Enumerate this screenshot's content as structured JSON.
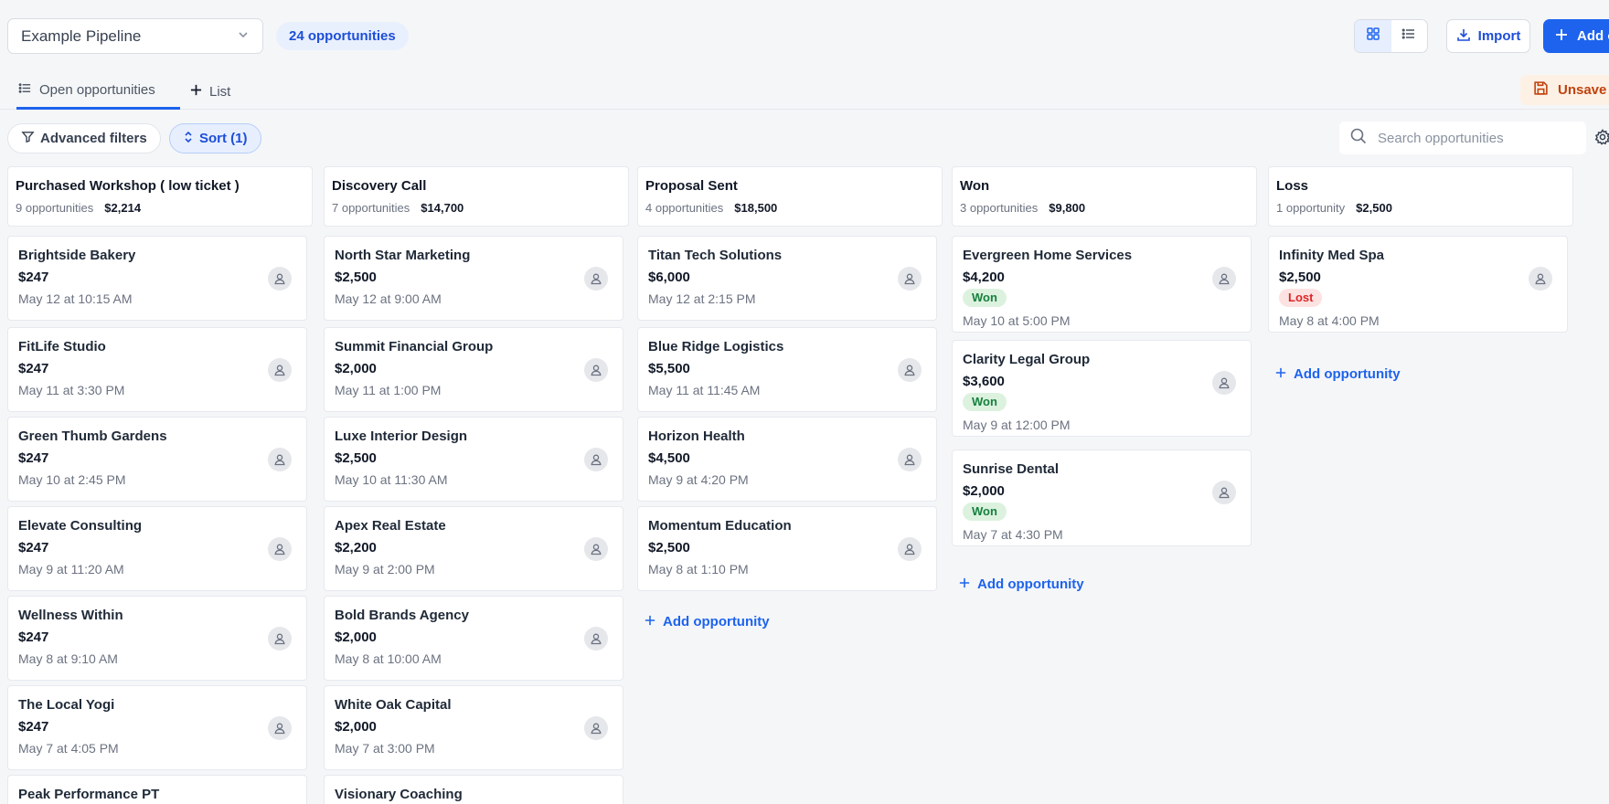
{
  "header": {
    "pipeline": "Example Pipeline",
    "opportunity_count": "24 opportunities",
    "import_label": "Import",
    "add_label": "Add o"
  },
  "tabs": {
    "open": "Open opportunities",
    "list": "List",
    "unsaved": "Unsave"
  },
  "filters": {
    "advanced": "Advanced filters",
    "sort": "Sort (1)",
    "search_placeholder": "Search opportunities"
  },
  "add_opportunity_label": "Add opportunity",
  "colors": {
    "accent": "#1d63ed",
    "won": "#15803d",
    "lost": "#dc2626",
    "warning": "#c2410c"
  },
  "columns": [
    {
      "title": "Purchased Workshop ( low ticket )",
      "count": "9 opportunities",
      "amount": "$2,214",
      "cards": [
        {
          "name": "Brightside Bakery",
          "amount": "$247",
          "date": "May 12 at 10:15 AM"
        },
        {
          "name": "FitLife Studio",
          "amount": "$247",
          "date": "May 11 at 3:30 PM"
        },
        {
          "name": "Green Thumb Gardens",
          "amount": "$247",
          "date": "May 10 at 2:45 PM"
        },
        {
          "name": "Elevate Consulting",
          "amount": "$247",
          "date": "May 9 at 11:20 AM"
        },
        {
          "name": "Wellness Within",
          "amount": "$247",
          "date": "May 8 at 9:10 AM"
        },
        {
          "name": "The Local Yogi",
          "amount": "$247",
          "date": "May 7 at 4:05 PM"
        },
        {
          "name": "Peak Performance PT",
          "amount": "",
          "date": ""
        }
      ]
    },
    {
      "title": "Discovery Call",
      "count": "7 opportunities",
      "amount": "$14,700",
      "cards": [
        {
          "name": "North Star Marketing",
          "amount": "$2,500",
          "date": "May 12 at 9:00 AM"
        },
        {
          "name": "Summit Financial Group",
          "amount": "$2,000",
          "date": "May 11 at 1:00 PM"
        },
        {
          "name": "Luxe Interior Design",
          "amount": "$2,500",
          "date": "May 10 at 11:30 AM"
        },
        {
          "name": "Apex Real Estate",
          "amount": "$2,200",
          "date": "May 9 at 2:00 PM"
        },
        {
          "name": "Bold Brands Agency",
          "amount": "$2,000",
          "date": "May 8 at 10:00 AM"
        },
        {
          "name": "White Oak Capital",
          "amount": "$2,000",
          "date": "May 7 at 3:00 PM"
        },
        {
          "name": "Visionary Coaching",
          "amount": "",
          "date": ""
        }
      ]
    },
    {
      "title": "Proposal Sent",
      "count": "4 opportunities",
      "amount": "$18,500",
      "cards": [
        {
          "name": "Titan Tech Solutions",
          "amount": "$6,000",
          "date": "May 12 at 2:15 PM"
        },
        {
          "name": "Blue Ridge Logistics",
          "amount": "$5,500",
          "date": "May 11 at 11:45 AM"
        },
        {
          "name": "Horizon Health",
          "amount": "$4,500",
          "date": "May 9 at 4:20 PM"
        },
        {
          "name": "Momentum Education",
          "amount": "$2,500",
          "date": "May 8 at 1:10 PM"
        }
      ]
    },
    {
      "title": "Won",
      "count": "3 opportunities",
      "amount": "$9,800",
      "cards": [
        {
          "name": "Evergreen Home Services",
          "amount": "$4,200",
          "badge": "Won",
          "date": "May 10 at 5:00 PM"
        },
        {
          "name": "Clarity Legal Group",
          "amount": "$3,600",
          "badge": "Won",
          "date": "May 9 at 12:00 PM"
        },
        {
          "name": "Sunrise Dental",
          "amount": "$2,000",
          "badge": "Won",
          "date": "May 7 at 4:30 PM"
        }
      ]
    },
    {
      "title": "Loss",
      "count": "1 opportunity",
      "amount": "$2,500",
      "cards": [
        {
          "name": "Infinity Med Spa",
          "amount": "$2,500",
          "badge": "Lost",
          "date": "May 8 at 4:00 PM"
        }
      ]
    }
  ]
}
